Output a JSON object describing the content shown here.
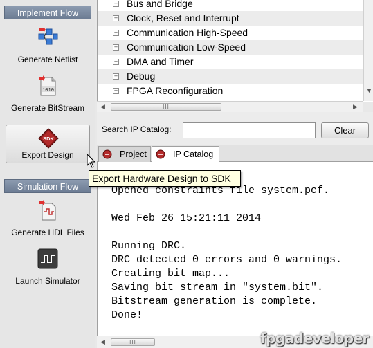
{
  "implement_flow": {
    "header": "Implement Flow",
    "buttons": [
      {
        "label": "Generate Netlist",
        "icon": "netlist-icon"
      },
      {
        "label": "Generate BitStream",
        "icon": "bitstream-icon"
      },
      {
        "label": "Export Design",
        "icon": "sdk-icon"
      }
    ]
  },
  "simulation_flow": {
    "header": "Simulation Flow",
    "buttons": [
      {
        "label": "Generate HDL Files",
        "icon": "hdl-files-icon"
      },
      {
        "label": "Launch Simulator",
        "icon": "simulator-icon"
      }
    ]
  },
  "ip_tree": {
    "items": [
      "Bus and Bridge",
      "Clock, Reset and Interrupt",
      "Communication High-Speed",
      "Communication Low-Speed",
      "DMA and Timer",
      "Debug",
      "FPGA Reconfiguration"
    ],
    "expander": "+"
  },
  "search": {
    "label": "Search IP Catalog:",
    "value": "",
    "clear_label": "Clear"
  },
  "tabs": [
    {
      "label": "Project",
      "active": false
    },
    {
      "label": "IP Catalog",
      "active": true
    }
  ],
  "tooltip": "Export Hardware Design to SDK",
  "console": {
    "text": "Opened constraints file system.pcf.\n\nWed Feb 26 15:21:11 2014\n\nRunning DRC.\nDRC detected 0 errors and 0 warnings.\nCreating bit map...\nSaving bit stream in \"system.bit\".\nBitstream generation is complete.\nDone!"
  },
  "scrollbar": {
    "grip": "III"
  },
  "sdk_icon_text": "SDK",
  "bitstream_icon_text": "1010",
  "watermark": "fpgadeveloper"
}
